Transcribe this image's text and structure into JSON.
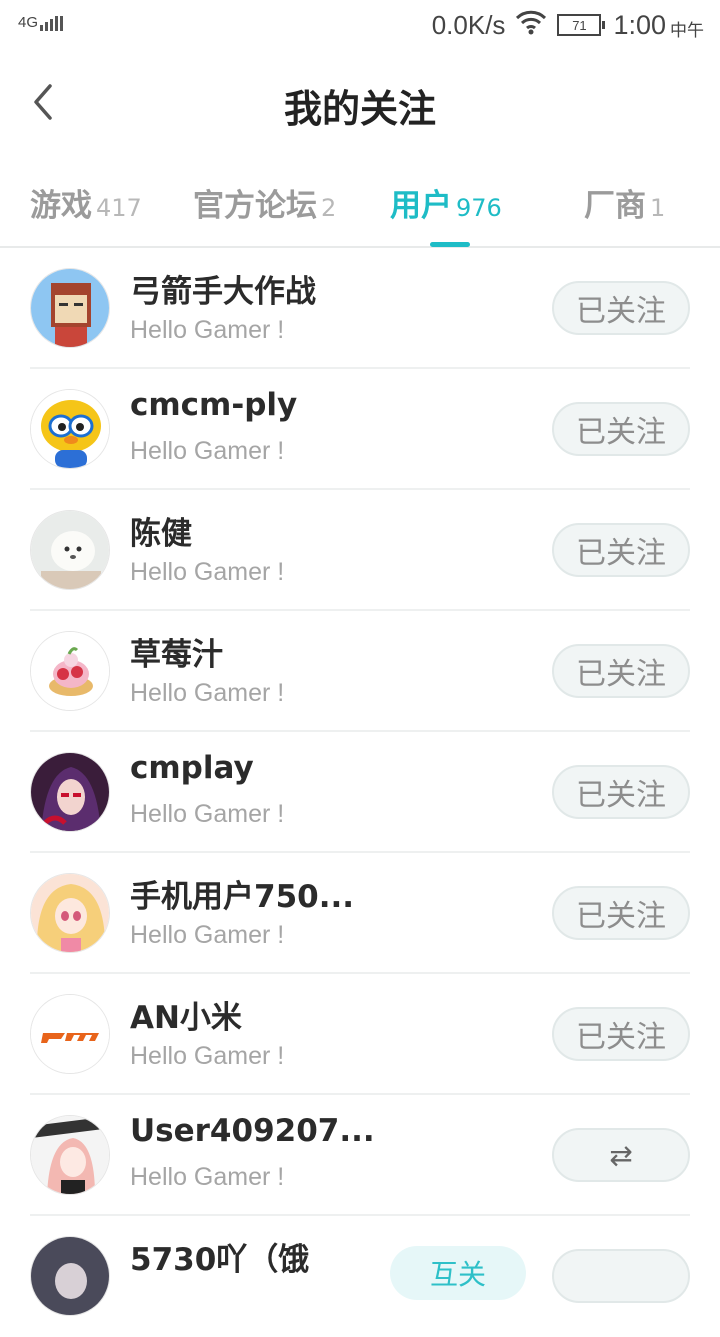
{
  "status_bar": {
    "network": "4G",
    "speed": "0.0K/s",
    "battery": "71",
    "time": "1:00",
    "ampm": "中午"
  },
  "header": {
    "title": "我的关注",
    "back_icon": "chevron-left-icon"
  },
  "tabs": [
    {
      "label": "游戏",
      "count": "417",
      "active": false
    },
    {
      "label": "官方论坛",
      "count": "2",
      "active": false
    },
    {
      "label": "用户",
      "count": "976",
      "active": true
    },
    {
      "label": "厂商",
      "count": "1",
      "active": false
    }
  ],
  "accent_color": "#1ebcc6",
  "users": [
    {
      "name": "弓箭手大作战",
      "subtitle": "Hello Gamer !",
      "button": "已关注"
    },
    {
      "name": "cmcm-ply",
      "subtitle": "Hello Gamer !",
      "button": "已关注"
    },
    {
      "name": "陈健",
      "subtitle": "Hello Gamer !",
      "button": "已关注"
    },
    {
      "name": "草莓汁",
      "subtitle": "Hello Gamer !",
      "button": "已关注"
    },
    {
      "name": "cmplay",
      "subtitle": "Hello Gamer !",
      "button": "已关注"
    },
    {
      "name": "手机用户750...",
      "subtitle": "Hello Gamer !",
      "button": "已关注"
    },
    {
      "name": "AN小米",
      "subtitle": "Hello Gamer !",
      "button": "已关注"
    },
    {
      "name": "User409207...",
      "subtitle": "Hello Gamer !",
      "button": "⇄",
      "mutual_icon": "swap-arrows-icon"
    },
    {
      "name": "5730吖（饿",
      "subtitle": "",
      "button": "",
      "tag": "互关"
    }
  ]
}
